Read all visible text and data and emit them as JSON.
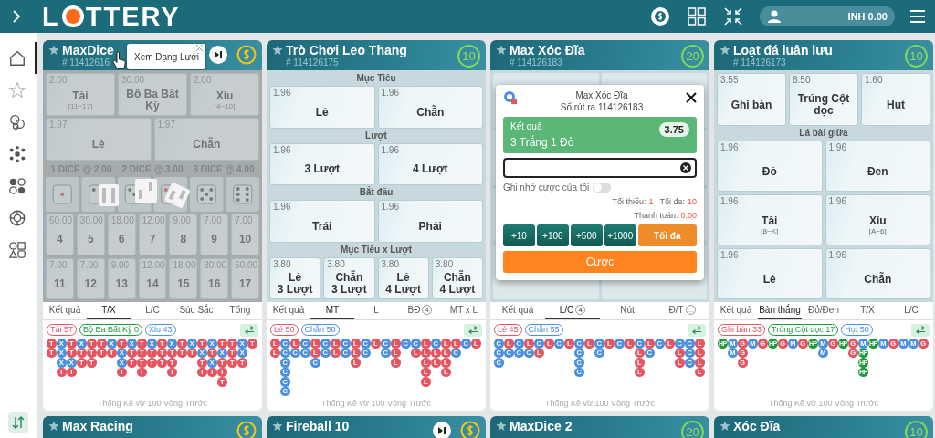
{
  "header": {
    "logo_start": "L",
    "logo_end": "TTERY",
    "balance": "INH 0.00"
  },
  "sidebar": {
    "items": [
      {
        "kind": "home",
        "selected": true
      },
      {
        "kind": "star",
        "selected": false
      },
      {
        "kind": "chips",
        "selected": false
      },
      {
        "kind": "cluster",
        "selected": false
      },
      {
        "kind": "dots",
        "selected": false
      },
      {
        "kind": "wheel",
        "selected": false
      },
      {
        "kind": "shapes",
        "selected": false
      }
    ]
  },
  "cards": [
    {
      "title": "MaxDice",
      "number": "# 11412616",
      "dimmed": true,
      "badge": {
        "kind": "coin",
        "play": true
      },
      "tooltip": "Xem Dạng Lưới",
      "sections": [
        {
          "kind": "tiles",
          "tiles": [
            {
              "odds": "2.00",
              "label": "Tài",
              "range": "[11~17]"
            },
            {
              "odds": "30.00",
              "label": "Bộ Ba Bất Kỳ"
            },
            {
              "odds": "2.00",
              "label": "Xỉu",
              "range": "[4~10]"
            }
          ]
        },
        {
          "kind": "tiles",
          "tiles": [
            {
              "odds": "1.97",
              "label": "Lẻ"
            },
            {
              "odds": "1.97",
              "label": "Chẵn"
            }
          ]
        },
        {
          "kind": "labels",
          "labels": [
            "1 DICE @ 2.00",
            "2 DICE @ 3.00",
            "3 DICE @ 4.00"
          ]
        },
        {
          "kind": "dice"
        },
        {
          "kind": "tiles",
          "tiles": [
            {
              "odds": "60.00",
              "label": "4"
            },
            {
              "odds": "30.00",
              "label": "5"
            },
            {
              "odds": "18.00",
              "label": "6"
            },
            {
              "odds": "12.00",
              "label": "7"
            },
            {
              "odds": "9.00",
              "label": "8"
            },
            {
              "odds": "7.00",
              "label": "9"
            },
            {
              "odds": "7.00",
              "label": "10"
            },
            {
              "odds": "7.00",
              "label": "11"
            },
            {
              "odds": "7.00",
              "label": "12"
            },
            {
              "odds": "9.00",
              "label": "13"
            },
            {
              "odds": "12.00",
              "label": "14"
            },
            {
              "odds": "18.00",
              "label": "15"
            },
            {
              "odds": "30.00",
              "label": "16"
            },
            {
              "odds": "60.00",
              "label": "17"
            }
          ]
        }
      ],
      "tabs": [
        {
          "label": "Kết quả",
          "selected": false
        },
        {
          "label": "T/X",
          "selected": true
        },
        {
          "label": "L/C",
          "selected": false
        },
        {
          "label": "Súc Sắc",
          "selected": false
        },
        {
          "label": "Tổng",
          "selected": false
        }
      ],
      "stats": [
        {
          "label": "Tài 57",
          "color": "#e65460"
        },
        {
          "label": "Bộ Ba Bất Kỳ 0",
          "color": "#1f9a3a"
        },
        {
          "label": "Xỉu 43",
          "color": "#4a90e2"
        }
      ],
      "road": [
        [
          {
            "t": "T",
            "color": "#e65460"
          },
          {
            "t": "T",
            "color": "#e65460"
          }
        ],
        [
          {
            "t": "X",
            "color": "#4a90e2"
          },
          {
            "t": "X",
            "color": "#4a90e2"
          },
          {
            "t": "X",
            "color": "#4a90e2"
          },
          {
            "t": "T",
            "color": "#e65460"
          }
        ],
        [
          {
            "t": "T",
            "color": "#e65460"
          },
          {
            "t": "T",
            "color": "#e65460"
          },
          {
            "t": "X",
            "color": "#4a90e2"
          },
          {
            "t": "T",
            "color": "#e65460"
          }
        ],
        [
          {
            "t": "X",
            "color": "#4a90e2"
          },
          {
            "t": "T",
            "color": "#e65460"
          },
          {
            "t": "T",
            "color": "#e65460"
          }
        ],
        [
          {
            "t": "T",
            "color": "#e65460"
          },
          {
            "t": "T",
            "color": "#e65460"
          },
          {
            "t": "T",
            "color": "#e65460"
          }
        ],
        [
          {
            "t": "T",
            "color": "#e65460"
          },
          {
            "t": "T",
            "color": "#e65460"
          }
        ],
        [
          {
            "t": "X",
            "color": "#4a90e2"
          },
          {
            "t": "T",
            "color": "#e65460"
          }
        ],
        [
          {
            "t": "T",
            "color": "#e65460"
          },
          {
            "t": "X",
            "color": "#4a90e2"
          },
          {
            "t": "X",
            "color": "#4a90e2"
          },
          {
            "t": "T",
            "color": "#e65460"
          }
        ],
        [
          {
            "t": "X",
            "color": "#4a90e2"
          },
          {
            "t": "T",
            "color": "#e65460"
          },
          {
            "t": "T",
            "color": "#e65460"
          }
        ],
        [
          {
            "t": "T",
            "color": "#e65460"
          },
          {
            "t": "T",
            "color": "#e65460"
          },
          {
            "t": "T",
            "color": "#e65460"
          },
          {
            "t": "T",
            "color": "#e65460"
          }
        ],
        [
          {
            "t": "X",
            "color": "#4a90e2"
          },
          {
            "t": "T",
            "color": "#e65460"
          },
          {
            "t": "T",
            "color": "#e65460"
          }
        ],
        [
          {
            "t": "T",
            "color": "#e65460"
          },
          {
            "t": "T",
            "color": "#e65460"
          },
          {
            "t": "T",
            "color": "#e65460"
          }
        ],
        [
          {
            "t": "X",
            "color": "#4a90e2"
          },
          {
            "t": "T",
            "color": "#e65460"
          },
          {
            "t": "T",
            "color": "#e65460"
          },
          {
            "t": "T",
            "color": "#e65460"
          }
        ],
        [
          {
            "t": "T",
            "color": "#e65460"
          },
          {
            "t": "T",
            "color": "#e65460"
          }
        ],
        [
          {
            "t": "X",
            "color": "#4a90e2"
          },
          {
            "t": "T",
            "color": "#e65460"
          }
        ],
        [
          {
            "t": "T",
            "color": "#e65460"
          },
          {
            "t": "X",
            "color": "#4a90e2"
          },
          {
            "t": "T",
            "color": "#e65460"
          },
          {
            "t": "T",
            "color": "#e65460"
          }
        ],
        [
          {
            "t": "X",
            "color": "#4a90e2"
          },
          {
            "t": "T",
            "color": "#e65460"
          },
          {
            "t": "X",
            "color": "#4a90e2"
          },
          {
            "t": "T",
            "color": "#e65460"
          }
        ],
        [
          {
            "t": "T",
            "color": "#e65460"
          },
          {
            "t": "X",
            "color": "#4a90e2"
          },
          {
            "t": "T",
            "color": "#e65460"
          },
          {
            "t": "T",
            "color": "#e65460"
          },
          {
            "t": "T",
            "color": "#e65460"
          }
        ],
        [
          {
            "t": "T",
            "color": "#e65460"
          },
          {
            "t": "T",
            "color": "#e65460"
          },
          {
            "t": "T",
            "color": "#e65460"
          }
        ],
        [
          {
            "t": "X",
            "color": "#4a90e2"
          },
          {
            "t": "X",
            "color": "#4a90e2"
          },
          {
            "t": "T",
            "color": "#e65460"
          }
        ],
        [
          {
            "t": "T",
            "color": "#e65460"
          }
        ]
      ],
      "footer": "Thống Kê vừ 100 Vòng Trước"
    },
    {
      "title": "Trò Chơi Leo Thang",
      "number": "# 114126175",
      "dimmed": false,
      "badge": {
        "kind": "timer",
        "text": "10"
      },
      "sections": [
        {
          "kind": "tiles",
          "heading": "Mục Tiêu",
          "tiles": [
            {
              "odds": "1.96",
              "label": "Lẻ"
            },
            {
              "odds": "1.96",
              "label": "Chẵn"
            }
          ]
        },
        {
          "kind": "tiles",
          "heading": "Lượt",
          "tiles": [
            {
              "odds": "1.96",
              "label": "3 Lượt"
            },
            {
              "odds": "1.96",
              "label": "4 Lượt"
            }
          ]
        },
        {
          "kind": "tiles",
          "heading": "Bắt đầu",
          "tiles": [
            {
              "odds": "1.96",
              "label": "Trái"
            },
            {
              "odds": "1.96",
              "label": "Phải"
            }
          ]
        },
        {
          "kind": "tiles",
          "heading": "Mục Tiêu x Lượt",
          "tiles": [
            {
              "odds": "3.80",
              "label": "Lẻ\n3 Lượt"
            },
            {
              "odds": "3.80",
              "label": "Chẵn\n3 Lượt"
            },
            {
              "odds": "3.80",
              "label": "Lẻ\n4 Lượt"
            },
            {
              "odds": "3.80",
              "label": "Chẵn\n4 Lượt"
            }
          ]
        }
      ],
      "tabs": [
        {
          "label": "Kết quả",
          "selected": false
        },
        {
          "label": "MT",
          "selected": true
        },
        {
          "label": "L",
          "selected": false
        },
        {
          "label": "BĐ",
          "selected": false,
          "count": "4"
        },
        {
          "label": "MT x L",
          "selected": false
        }
      ],
      "stats": [
        {
          "label": "Lẻ 50",
          "color": "#e65460"
        },
        {
          "label": "Chẵn 50",
          "color": "#4a90e2"
        }
      ],
      "road": [
        [
          {
            "t": "L",
            "color": "#e65460"
          },
          {
            "t": "L",
            "color": "#e65460"
          }
        ],
        [
          {
            "t": "C",
            "color": "#4a90e2"
          },
          {
            "t": "C",
            "color": "#4a90e2"
          },
          {
            "t": "C",
            "color": "#4a90e2"
          },
          {
            "t": "C",
            "color": "#4a90e2"
          },
          {
            "t": "C",
            "color": "#4a90e2"
          },
          {
            "t": "C",
            "color": "#4a90e2"
          }
        ],
        [
          {
            "t": "L",
            "color": "#e65460"
          },
          {
            "t": "C",
            "color": "#4a90e2"
          }
        ],
        [
          {
            "t": "C",
            "color": "#4a90e2"
          },
          {
            "t": "C",
            "color": "#4a90e2"
          }
        ],
        [
          {
            "t": "L",
            "color": "#e65460"
          },
          {
            "t": "L",
            "color": "#e65460"
          },
          {
            "t": "C",
            "color": "#4a90e2"
          }
        ],
        [
          {
            "t": "C",
            "color": "#4a90e2"
          },
          {
            "t": "C",
            "color": "#4a90e2"
          }
        ],
        [
          {
            "t": "L",
            "color": "#e65460"
          },
          {
            "t": "L",
            "color": "#e65460"
          }
        ],
        [
          {
            "t": "C",
            "color": "#4a90e2"
          },
          {
            "t": "C",
            "color": "#4a90e2"
          }
        ],
        [
          {
            "t": "L",
            "color": "#e65460"
          },
          {
            "t": "L",
            "color": "#e65460"
          },
          {
            "t": "L",
            "color": "#e65460"
          }
        ],
        [
          {
            "t": "C",
            "color": "#4a90e2"
          },
          {
            "t": "C",
            "color": "#4a90e2"
          }
        ],
        [
          {
            "t": "L",
            "color": "#e65460"
          }
        ],
        [
          {
            "t": "C",
            "color": "#4a90e2"
          },
          {
            "t": "C",
            "color": "#4a90e2"
          }
        ],
        [
          {
            "t": "L",
            "color": "#e65460"
          },
          {
            "t": "L",
            "color": "#e65460"
          },
          {
            "t": "L",
            "color": "#e65460"
          }
        ],
        [
          {
            "t": "C",
            "color": "#4a90e2"
          }
        ],
        [
          {
            "t": "C",
            "color": "#4a90e2"
          },
          {
            "t": "L",
            "color": "#e65460"
          }
        ],
        [
          {
            "t": "L",
            "color": "#e65460"
          },
          {
            "t": "L",
            "color": "#e65460"
          },
          {
            "t": "L",
            "color": "#e65460"
          },
          {
            "t": "L",
            "color": "#e65460"
          },
          {
            "t": "L",
            "color": "#e65460"
          }
        ],
        [
          {
            "t": "C",
            "color": "#4a90e2"
          },
          {
            "t": "L",
            "color": "#e65460"
          },
          {
            "t": "L",
            "color": "#e65460"
          }
        ],
        [
          {
            "t": "L",
            "color": "#e65460"
          },
          {
            "t": "L",
            "color": "#e65460"
          },
          {
            "t": "L",
            "color": "#e65460"
          },
          {
            "t": "L",
            "color": "#e65460"
          }
        ],
        [
          {
            "t": "L",
            "color": "#e65460"
          },
          {
            "t": "C",
            "color": "#4a90e2"
          }
        ],
        [
          {
            "t": "C",
            "color": "#4a90e2"
          }
        ],
        [
          {
            "t": "L",
            "color": "#e65460"
          }
        ]
      ],
      "footer": "Thống Kê vừ 100 Vòng Trước"
    },
    {
      "title": "Max Xóc Đĩa",
      "number": "# 114126183",
      "dimmed": false,
      "badge": {
        "kind": "timer",
        "text": "20"
      },
      "modal": {
        "title": "Max Xóc Đĩa",
        "draw": "Số rút ra 114126183",
        "result_label": "Kết quả",
        "result": "3 Trắng 1 Đỏ",
        "payout": "3.75",
        "remember_label": "Ghi nhớ cược của tôi",
        "remember": false,
        "min_label": "Tối thiểu:",
        "min": "1",
        "max_label": "Tối đa:",
        "max": "10",
        "pay_label": "Thanh toán:",
        "pay": "0.00",
        "chips": [
          "+10",
          "+100",
          "+500",
          "+1000"
        ],
        "max_button": "Tối đa",
        "bet_button": "Cược"
      },
      "tabs": [
        {
          "label": "Kết quả",
          "selected": false
        },
        {
          "label": "L/C",
          "selected": true,
          "count": "4"
        },
        {
          "label": "Nút",
          "selected": false
        },
        {
          "label": "Đ/T",
          "selected": false,
          "count": "…"
        }
      ],
      "stats": [
        {
          "label": "Lẻ 45",
          "color": "#e65460"
        },
        {
          "label": "Chẵn 55",
          "color": "#4a90e2"
        }
      ],
      "road": [
        [
          {
            "t": "C",
            "color": "#4a90e2"
          },
          {
            "t": "C",
            "color": "#4a90e2"
          },
          {
            "t": "C",
            "color": "#4a90e2"
          }
        ],
        [
          {
            "t": "L",
            "color": "#e65460"
          },
          {
            "t": "C",
            "color": "#4a90e2"
          }
        ],
        [
          {
            "t": "C",
            "color": "#4a90e2"
          },
          {
            "t": "C",
            "color": "#4a90e2"
          }
        ],
        [
          {
            "t": "L",
            "color": "#e65460"
          },
          {
            "t": "C",
            "color": "#4a90e2"
          }
        ],
        [
          {
            "t": "C",
            "color": "#4a90e2"
          },
          {
            "t": "L",
            "color": "#e65460"
          }
        ],
        [
          {
            "t": "L",
            "color": "#e65460"
          }
        ],
        [
          {
            "t": "C",
            "color": "#4a90e2"
          }
        ],
        [
          {
            "t": "L",
            "color": "#e65460"
          }
        ],
        [
          {
            "t": "C",
            "color": "#4a90e2"
          },
          {
            "t": "C",
            "color": "#4a90e2"
          },
          {
            "t": "C",
            "color": "#4a90e2"
          },
          {
            "t": "C",
            "color": "#4a90e2"
          }
        ],
        [
          {
            "t": "L",
            "color": "#e65460"
          }
        ],
        [
          {
            "t": "C",
            "color": "#4a90e2"
          },
          {
            "t": "C",
            "color": "#4a90e2"
          }
        ],
        [
          {
            "t": "L",
            "color": "#e65460"
          }
        ],
        [
          {
            "t": "C",
            "color": "#4a90e2"
          }
        ],
        [
          {
            "t": "L",
            "color": "#e65460"
          }
        ],
        [
          {
            "t": "C",
            "color": "#4a90e2"
          },
          {
            "t": "L",
            "color": "#e65460"
          },
          {
            "t": "L",
            "color": "#e65460"
          },
          {
            "t": "L",
            "color": "#e65460"
          }
        ],
        [
          {
            "t": "L",
            "color": "#e65460"
          },
          {
            "t": "C",
            "color": "#4a90e2"
          }
        ],
        [
          {
            "t": "C",
            "color": "#4a90e2"
          }
        ],
        [
          {
            "t": "L",
            "color": "#e65460"
          }
        ],
        [
          {
            "t": "C",
            "color": "#4a90e2"
          },
          {
            "t": "L",
            "color": "#e65460"
          },
          {
            "t": "L",
            "color": "#e65460"
          }
        ],
        [
          {
            "t": "C",
            "color": "#4a90e2"
          },
          {
            "t": "C",
            "color": "#4a90e2"
          },
          {
            "t": "C",
            "color": "#4a90e2"
          }
        ],
        [
          {
            "t": "L",
            "color": "#e65460"
          },
          {
            "t": "L",
            "color": "#e65460"
          },
          {
            "t": "L",
            "color": "#e65460"
          },
          {
            "t": "L",
            "color": "#e65460"
          }
        ]
      ],
      "footer": "Thống Kê vừ 100 Vòng Trước"
    },
    {
      "title": "Loạt đá luân lưu",
      "number": "# 114126173",
      "dimmed": false,
      "badge": {
        "kind": "timer",
        "text": "10"
      },
      "sections": [
        {
          "kind": "tiles",
          "tiles": [
            {
              "odds": "3.55",
              "label": "Ghi bàn"
            },
            {
              "odds": "8.50",
              "label": "Trúng Cột dọc"
            },
            {
              "odds": "1.60",
              "label": "Hụt"
            }
          ]
        },
        {
          "kind": "tiles",
          "heading": "Lá bài giữa",
          "tiles": [
            {
              "odds": "1.96",
              "label": "Đỏ"
            },
            {
              "odds": "1.96",
              "label": "Đen"
            },
            {
              "odds": "1.96",
              "label": "Tài",
              "range": "[8~K]"
            },
            {
              "odds": "1.96",
              "label": "Xỉu",
              "range": "[A~6]"
            },
            {
              "odds": "1.96",
              "label": "Lẻ"
            },
            {
              "odds": "1.96",
              "label": "Chẵn"
            }
          ]
        }
      ],
      "tabs": [
        {
          "label": "Kết quả",
          "selected": false
        },
        {
          "label": "Bản thắng",
          "selected": true
        },
        {
          "label": "Đỏ/Đen",
          "selected": false
        },
        {
          "label": "T/X",
          "selected": false
        },
        {
          "label": "L/C",
          "selected": false
        }
      ],
      "stats": [
        {
          "label": "Ghi bàn 33",
          "color": "#e65460"
        },
        {
          "label": "Trúng Cột dọc 17",
          "color": "#1f9a3a"
        },
        {
          "label": "Hụt 50",
          "color": "#4a90e2"
        }
      ],
      "road": [
        [
          {
            "t": "HP",
            "color": "#1f9a3a"
          }
        ],
        [
          {
            "t": "M",
            "color": "#4a90e2"
          },
          {
            "t": "M",
            "color": "#4a90e2"
          }
        ],
        [
          {
            "t": "G",
            "color": "#e65460"
          },
          {
            "t": "G",
            "color": "#e65460"
          },
          {
            "t": "G",
            "color": "#e65460"
          }
        ],
        [
          {
            "t": "M",
            "color": "#4a90e2"
          }
        ],
        [
          {
            "t": "G",
            "color": "#e65460"
          }
        ],
        [
          {
            "t": "HP",
            "color": "#1f9a3a"
          }
        ],
        [
          {
            "t": "G",
            "color": "#e65460"
          }
        ],
        [
          {
            "t": "M",
            "color": "#4a90e2"
          }
        ],
        [
          {
            "t": "G",
            "color": "#e65460"
          }
        ],
        [
          {
            "t": "HP",
            "color": "#1f9a3a"
          }
        ],
        [
          {
            "t": "M",
            "color": "#4a90e2"
          },
          {
            "t": "M",
            "color": "#4a90e2"
          }
        ],
        [
          {
            "t": "G",
            "color": "#e65460"
          }
        ],
        [
          {
            "t": "HP",
            "color": "#1f9a3a"
          }
        ],
        [
          {
            "t": "G",
            "color": "#e65460"
          },
          {
            "t": "G",
            "color": "#e65460"
          }
        ],
        [
          {
            "t": "M",
            "color": "#4a90e2"
          },
          {
            "t": "HP",
            "color": "#1f9a3a"
          },
          {
            "t": "HP",
            "color": "#1f9a3a"
          },
          {
            "t": "HP",
            "color": "#1f9a3a"
          }
        ],
        [
          {
            "t": "HP",
            "color": "#1f9a3a"
          }
        ],
        [
          {
            "t": "M",
            "color": "#4a90e2"
          }
        ],
        [
          {
            "t": "G",
            "color": "#e65460"
          }
        ],
        [
          {
            "t": "M",
            "color": "#4a90e2"
          }
        ],
        [
          {
            "t": "M",
            "color": "#4a90e2"
          }
        ],
        [
          {
            "t": "G",
            "color": "#e65460"
          }
        ]
      ],
      "footer": "Thống Kê vừ 100 Vòng Trước"
    }
  ],
  "bottom_cards": [
    {
      "title": "Max Racing",
      "badge": {
        "kind": "coin",
        "play": false
      }
    },
    {
      "title": "Fireball 10",
      "badge": {
        "kind": "coin",
        "play": true
      }
    },
    {
      "title": "MaxDice 2",
      "badge": {
        "kind": "timer",
        "text": "20"
      }
    },
    {
      "title": "Xóc Đĩa",
      "badge": {
        "kind": "timer",
        "text": "10"
      }
    }
  ]
}
